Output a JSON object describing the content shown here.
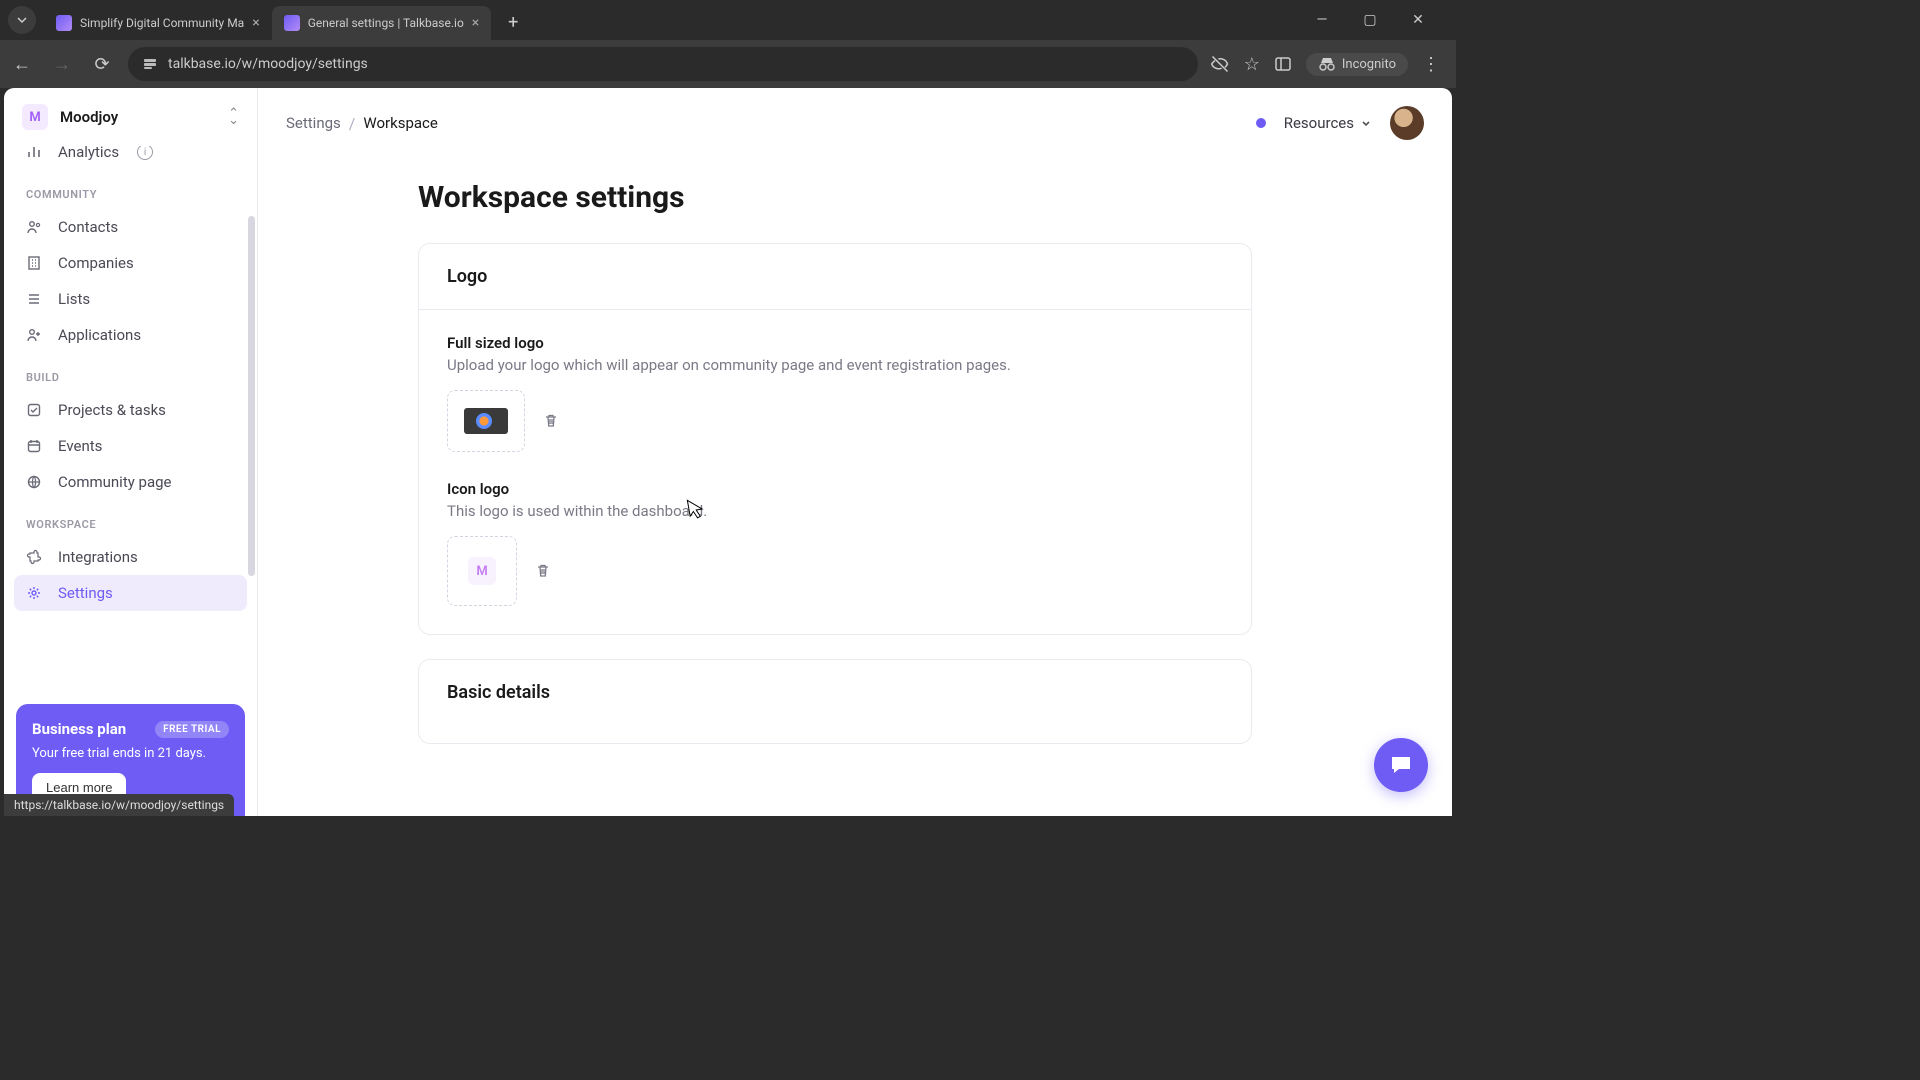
{
  "browser": {
    "tabs": [
      {
        "title": "Simplify Digital Community Ma"
      },
      {
        "title": "General settings | Talkbase.io"
      }
    ],
    "url": "talkbase.io/w/moodjoy/settings",
    "incognito_label": "Incognito"
  },
  "workspace_switcher": {
    "initial": "M",
    "name": "Moodjoy"
  },
  "sidebar": {
    "analytics_label": "Analytics",
    "section_community": "COMMUNITY",
    "contacts": "Contacts",
    "companies": "Companies",
    "lists": "Lists",
    "applications": "Applications",
    "section_build": "BUILD",
    "projects": "Projects & tasks",
    "events": "Events",
    "community_page": "Community page",
    "section_workspace": "WORKSPACE",
    "integrations": "Integrations",
    "settings": "Settings"
  },
  "trial": {
    "title": "Business plan",
    "badge": "FREE TRIAL",
    "subtitle": "Your free trial ends in 21 days.",
    "cta": "Learn more"
  },
  "breadcrumb": {
    "root": "Settings",
    "current": "Workspace"
  },
  "topbar": {
    "resources": "Resources"
  },
  "page": {
    "title": "Workspace settings",
    "logo_section": "Logo",
    "full_logo_title": "Full sized logo",
    "full_logo_desc": "Upload your logo which will appear on community page and event registration pages.",
    "icon_logo_title": "Icon logo",
    "icon_logo_desc": "This logo is used within the dashboard.",
    "icon_letter": "M",
    "basic_details": "Basic details"
  },
  "status_url": "https://talkbase.io/w/moodjoy/settings"
}
